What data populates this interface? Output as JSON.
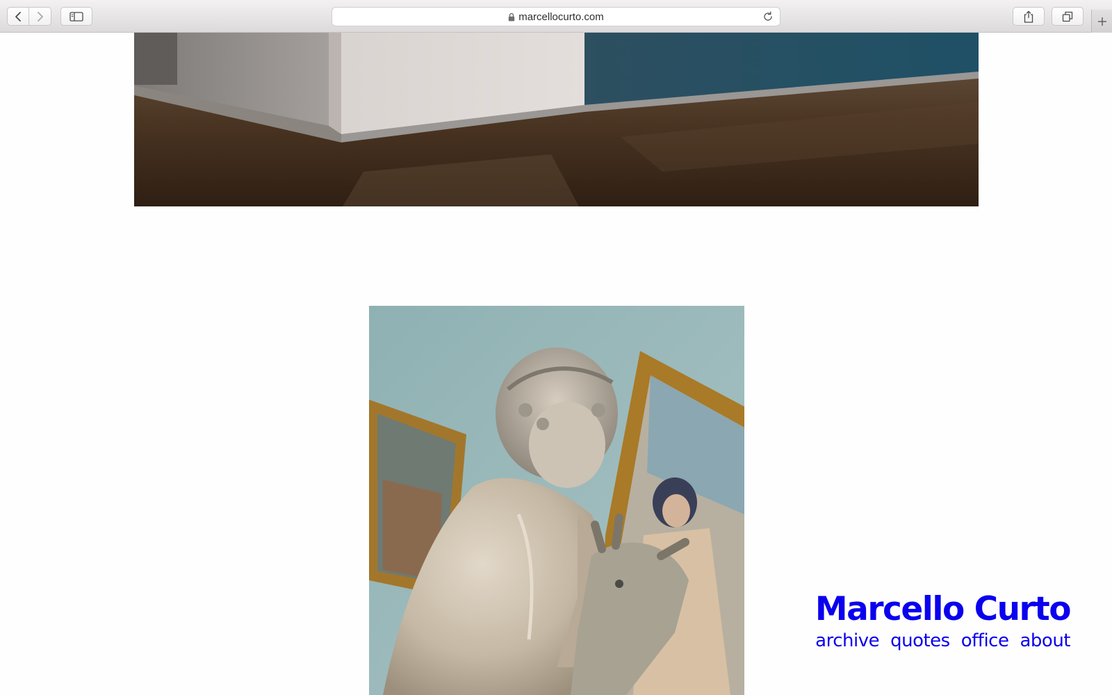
{
  "browser": {
    "url": "marcellocurto.com"
  },
  "site": {
    "title": "Marcello Curto",
    "nav": [
      "archive",
      "quotes",
      "office",
      "about"
    ]
  },
  "colors": {
    "brand_blue": "#0a00ee",
    "page_background": "#fefefe"
  }
}
